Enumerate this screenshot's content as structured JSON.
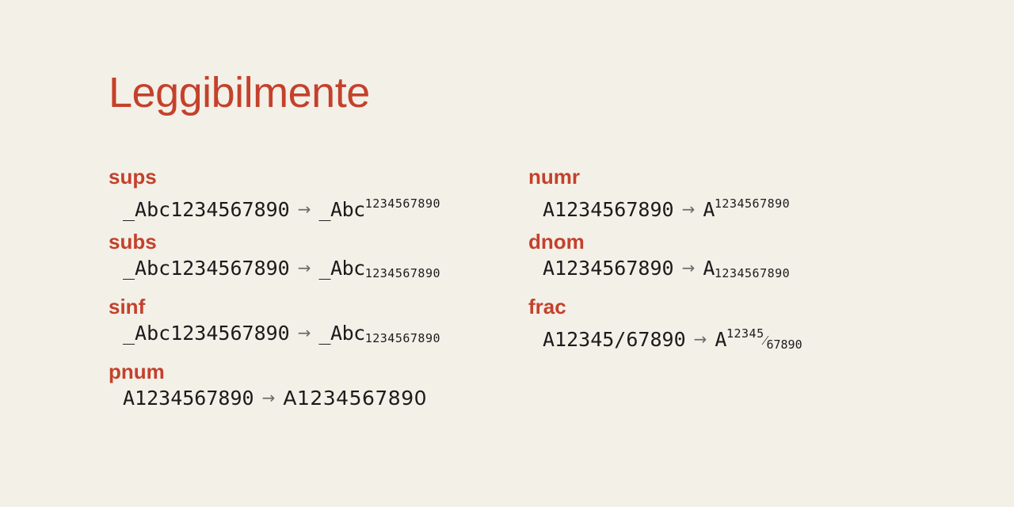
{
  "title": "Leggibilmente",
  "arrow": "→",
  "colors": {
    "accent": "#c4412b",
    "text": "#1b1b1b",
    "background": "#f3f0e8"
  },
  "features": {
    "sups": {
      "name": "sups",
      "input": "_Abc1234567890",
      "result_base": "_Abc",
      "result_digits": "1234567890"
    },
    "subs": {
      "name": "subs",
      "input": "_Abc1234567890",
      "result_base": "_Abc",
      "result_digits": "1234567890"
    },
    "sinf": {
      "name": "sinf",
      "input": "_Abc1234567890",
      "result_base": "_Abc",
      "result_digits": "1234567890"
    },
    "pnum": {
      "name": "pnum",
      "input": "A1234567890",
      "result": "A1234567890"
    },
    "numr": {
      "name": "numr",
      "input": "A1234567890",
      "result_base": "A",
      "result_digits": "1234567890"
    },
    "dnom": {
      "name": "dnom",
      "input": "A1234567890",
      "result_base": "A",
      "result_digits": "1234567890"
    },
    "frac": {
      "name": "frac",
      "input": "A12345/67890",
      "result_base": "A",
      "result_numerator": "12345",
      "result_slash": "⁄",
      "result_denominator": "67890"
    }
  }
}
